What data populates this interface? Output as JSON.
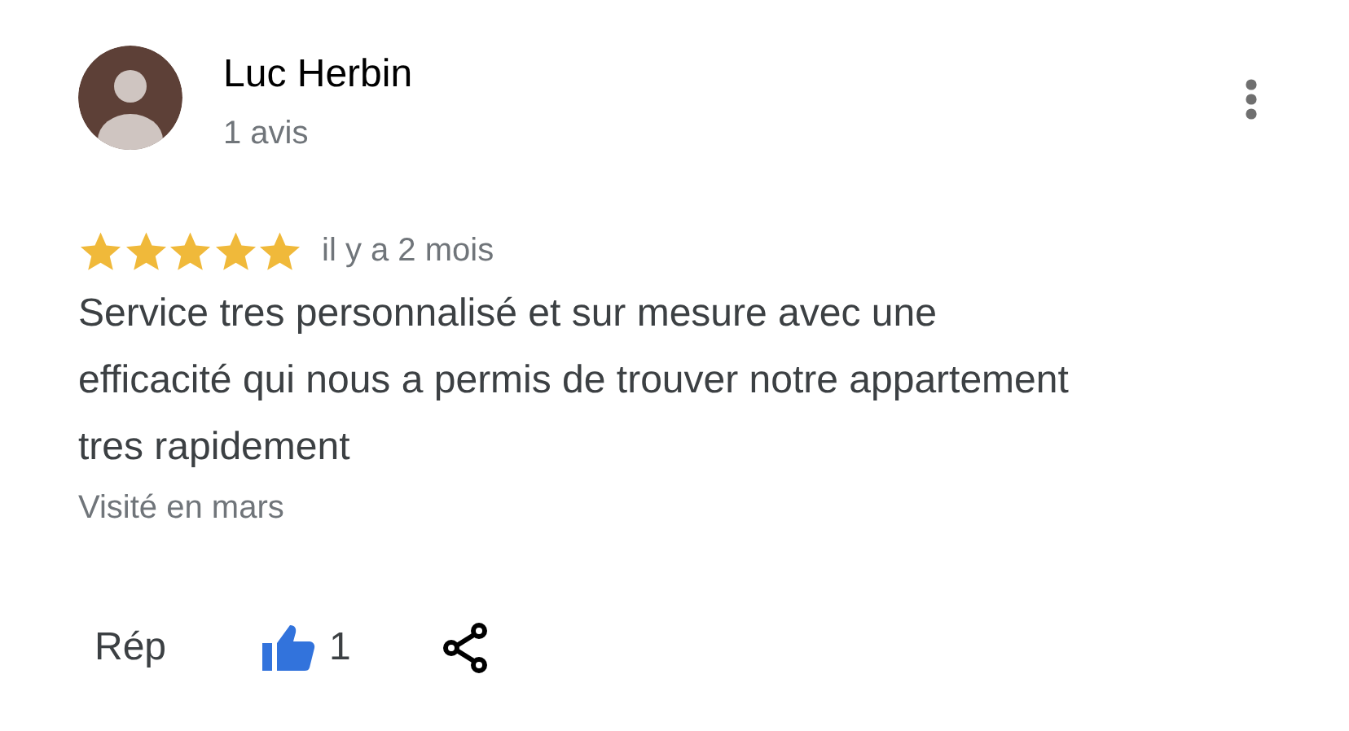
{
  "review": {
    "author": "Luc Herbin",
    "review_count": "1 avis",
    "stars": 5,
    "time": "il y a 2 mois",
    "text": "Service tres personnalisé et sur mesure avec une efficacité qui nous a permis de trouver notre appartement tres rapidement",
    "visited": "Visité en mars"
  },
  "actions": {
    "reply": "Rép",
    "like": {
      "count": "1",
      "liked": true
    }
  }
}
